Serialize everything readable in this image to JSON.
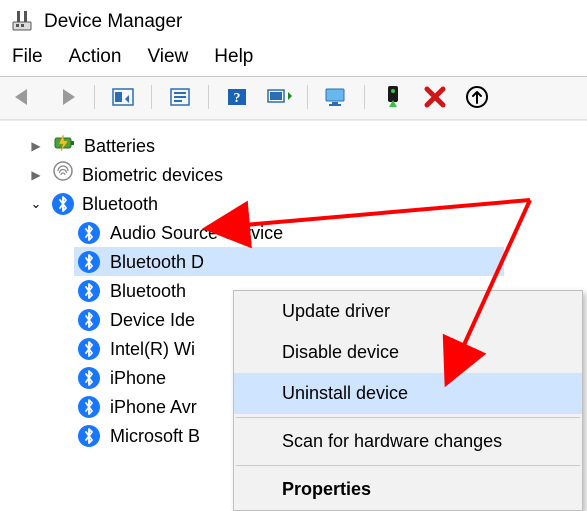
{
  "window": {
    "title": "Device Manager"
  },
  "menu": {
    "file": "File",
    "action": "Action",
    "view": "View",
    "help": "Help"
  },
  "tree": {
    "batteries": {
      "label": "Batteries"
    },
    "biometric": {
      "label": "Biometric devices"
    },
    "bluetooth": {
      "label": "Bluetooth",
      "children": [
        "Audio Source Service",
        "Bluetooth D",
        "Bluetooth",
        "Device Ide",
        "Intel(R) Wi",
        "iPhone",
        "iPhone Avr",
        "Microsoft B"
      ],
      "selected_index": 1
    }
  },
  "context_menu": {
    "update": "Update driver",
    "disable": "Disable device",
    "uninstall": "Uninstall device",
    "scan": "Scan for hardware changes",
    "properties": "Properties"
  }
}
